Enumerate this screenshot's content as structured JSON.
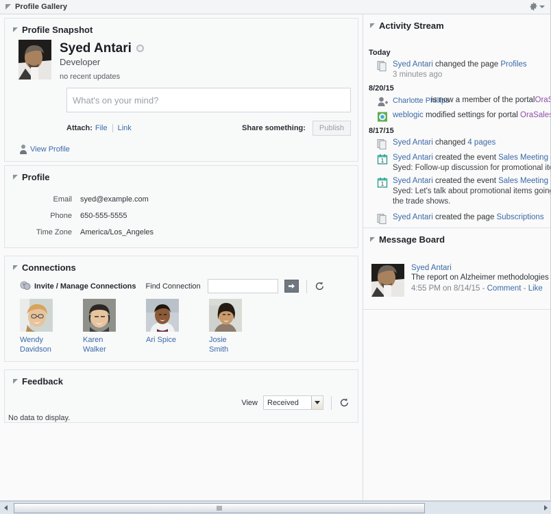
{
  "window": {
    "title": "Profile Gallery",
    "gear_icon": "gear-icon",
    "caret_icon": "chevron-down-icon"
  },
  "profile_snapshot": {
    "title": "Profile Snapshot",
    "name": "Syed Antari",
    "job_title": "Developer",
    "status_text": "no recent updates",
    "presence_icon": "presence-offline-icon",
    "compose_placeholder": "What's on your mind?",
    "compose_value": "",
    "attach_label": "Attach:",
    "attach_file": "File",
    "attach_link": "Link",
    "share_label": "Share something:",
    "publish_label": "Publish",
    "view_profile_label": "View Profile",
    "view_profile_icon": "person-icon"
  },
  "profile": {
    "title": "Profile",
    "fields": [
      {
        "label": "Email",
        "value": "syed@example.com"
      },
      {
        "label": "Phone",
        "value": "650-555-5555"
      },
      {
        "label": "Time Zone",
        "value": "America/Los_Angeles"
      }
    ]
  },
  "connections": {
    "title": "Connections",
    "manage_label": "Invite / Manage Connections",
    "manage_icon": "people-icon",
    "find_label": "Find Connection",
    "find_value": "",
    "go_icon": "arrow-right-icon",
    "refresh_icon": "refresh-icon",
    "people": [
      {
        "name": "Wendy Davidson"
      },
      {
        "name": "Karen Walker"
      },
      {
        "name": "Ari Spice"
      },
      {
        "name": "Josie Smith"
      }
    ]
  },
  "feedback": {
    "title": "Feedback",
    "view_label": "View",
    "selected_option": "Received",
    "options": [
      "Received"
    ],
    "refresh_icon": "refresh-icon",
    "empty_text": "No data to display."
  },
  "activity_stream": {
    "title": "Activity Stream",
    "groups": [
      {
        "date": "Today",
        "items": [
          {
            "icon": "pages-icon",
            "actor": "Syed Antari",
            "text": " changed the page ",
            "object": "Profiles",
            "time": "3 minutes ago"
          }
        ]
      },
      {
        "date": "8/20/15",
        "items": [
          {
            "icon": "add-person-icon",
            "actor": "Charlotte Phillips",
            "text": "is now a member of the portal ",
            "portal": "OraSale"
          },
          {
            "icon": "settings-portal-icon",
            "actor": "weblogic",
            "text": " modified settings for portal ",
            "portal": "OraSales"
          }
        ]
      },
      {
        "date": "8/17/15",
        "items": [
          {
            "icon": "pages-icon",
            "actor": "Syed Antari",
            "text": " changed ",
            "object": "4 pages"
          },
          {
            "icon": "calendar-icon",
            "actor": "Syed Antari",
            "text": " created the event ",
            "object": "Sales Meeting",
            "detail": "Syed: Follow-up discussion for promotional items"
          },
          {
            "icon": "calendar-icon",
            "actor": "Syed Antari",
            "text": " created the event ",
            "object": "Sales Meeting",
            "detail": "Syed: Let's talk about promotional items going to the trade shows."
          },
          {
            "icon": "pages-icon",
            "actor": "Syed Antari",
            "text": " created the page ",
            "object": "Subscriptions"
          }
        ]
      }
    ]
  },
  "message_board": {
    "title": "Message Board",
    "author": "Syed Antari",
    "message": "The report on Alzheimer methodologies is due for the consortium on Tuesday. It'll be a good idea to review the FAQs!",
    "timestamp": "4:55 PM on 8/14/15",
    "comment_label": "Comment",
    "like_label": "Like",
    "separator": "-"
  },
  "scrollbar": {
    "left_icon": "scroll-left-arrow-icon",
    "right_icon": "scroll-right-arrow-icon",
    "thumb_grip_icon": "scroll-grip-icon"
  },
  "colors": {
    "link": "#3a69a8",
    "portal_link": "#8c4fa8",
    "panel_bg": "#f8f9f9",
    "panel_border": "#dfe4e8"
  }
}
